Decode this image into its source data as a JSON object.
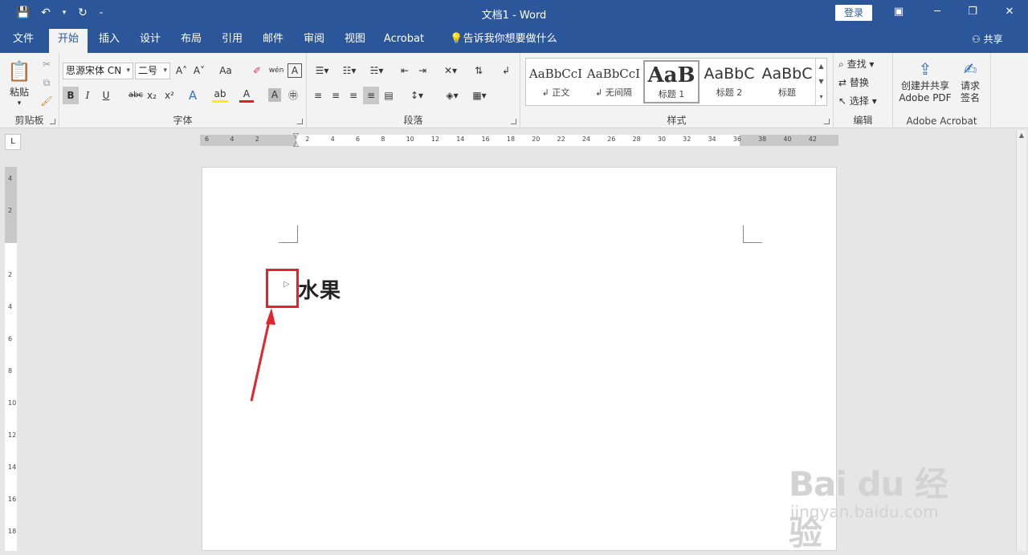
{
  "window": {
    "title": "文档1  -  Word",
    "login_label": "登录",
    "qat": {
      "save_icon": "💾",
      "undo_icon": "↶",
      "undo_arrow": "▾",
      "redo_icon": "↻",
      "customize_icon": "₌"
    },
    "controls": {
      "restore_ribbon": "▣",
      "minimize": "─",
      "maximize": "❐",
      "close": "✕"
    }
  },
  "tabs": [
    {
      "label": "文件"
    },
    {
      "label": "开始",
      "active": true
    },
    {
      "label": "插入"
    },
    {
      "label": "设计"
    },
    {
      "label": "布局"
    },
    {
      "label": "引用"
    },
    {
      "label": "邮件"
    },
    {
      "label": "审阅"
    },
    {
      "label": "视图"
    },
    {
      "label": "Acrobat"
    },
    {
      "label": "告诉我你想要做什么"
    }
  ],
  "share_label": "共享",
  "ribbon": {
    "clipboard": {
      "group_label": "剪贴板",
      "paste_label": "粘贴",
      "paste_arrow": "▾"
    },
    "font": {
      "group_label": "字体",
      "font_name": "思源宋体 CN",
      "font_size": "二号",
      "grow": "A˄",
      "shrink": "A˅",
      "case": "Aa",
      "clear": "✐",
      "phonetic": "wén",
      "border_char": "A",
      "bold": "B",
      "italic": "I",
      "underline": "U",
      "strike": "abc",
      "sub": "x₂",
      "sup": "x²",
      "effects": "A",
      "highlight": "ab",
      "color": "A",
      "shading": "A",
      "enclose": "㊥"
    },
    "paragraph": {
      "group_label": "段落"
    },
    "styles": {
      "group_label": "样式",
      "items": [
        {
          "preview": "AaBbCcI",
          "name": "↲ 正文"
        },
        {
          "preview": "AaBbCcI",
          "name": "↲ 无间隔"
        },
        {
          "preview": "AaB",
          "name": "标题 1"
        },
        {
          "preview": "AaBbC",
          "name": "标题 2"
        },
        {
          "preview": "AaBbC",
          "name": "标题"
        }
      ],
      "scroll_up": "▲",
      "scroll_down": "▼",
      "more": "▾"
    },
    "editing": {
      "group_label": "编辑",
      "find": "查找",
      "replace": "替换",
      "select": "选择"
    },
    "acrobat": {
      "group_label": "Adobe Acrobat",
      "create_share": "创建并共享\nAdobe PDF",
      "create_line1": "创建并共享",
      "create_line2": "Adobe PDF",
      "sign_line1": "请求",
      "sign_line2": "签名"
    }
  },
  "ruler": {
    "tab_selector": "L",
    "h_labels": [
      "6",
      "4",
      "2",
      "",
      "2",
      "4",
      "6",
      "8",
      "10",
      "12",
      "14",
      "16",
      "18",
      "20",
      "22",
      "24",
      "26",
      "28",
      "30",
      "32",
      "34",
      "36",
      "38",
      "40",
      "42"
    ],
    "v_labels": [
      "4",
      "2",
      "",
      "2",
      "4",
      "6",
      "8",
      "10",
      "12",
      "14",
      "16",
      "18"
    ]
  },
  "document": {
    "heading_text": "水果",
    "collapse_glyph": "▷"
  },
  "watermark": {
    "brand": "Bai du 经验",
    "url": "jingyan.baidu.com"
  }
}
